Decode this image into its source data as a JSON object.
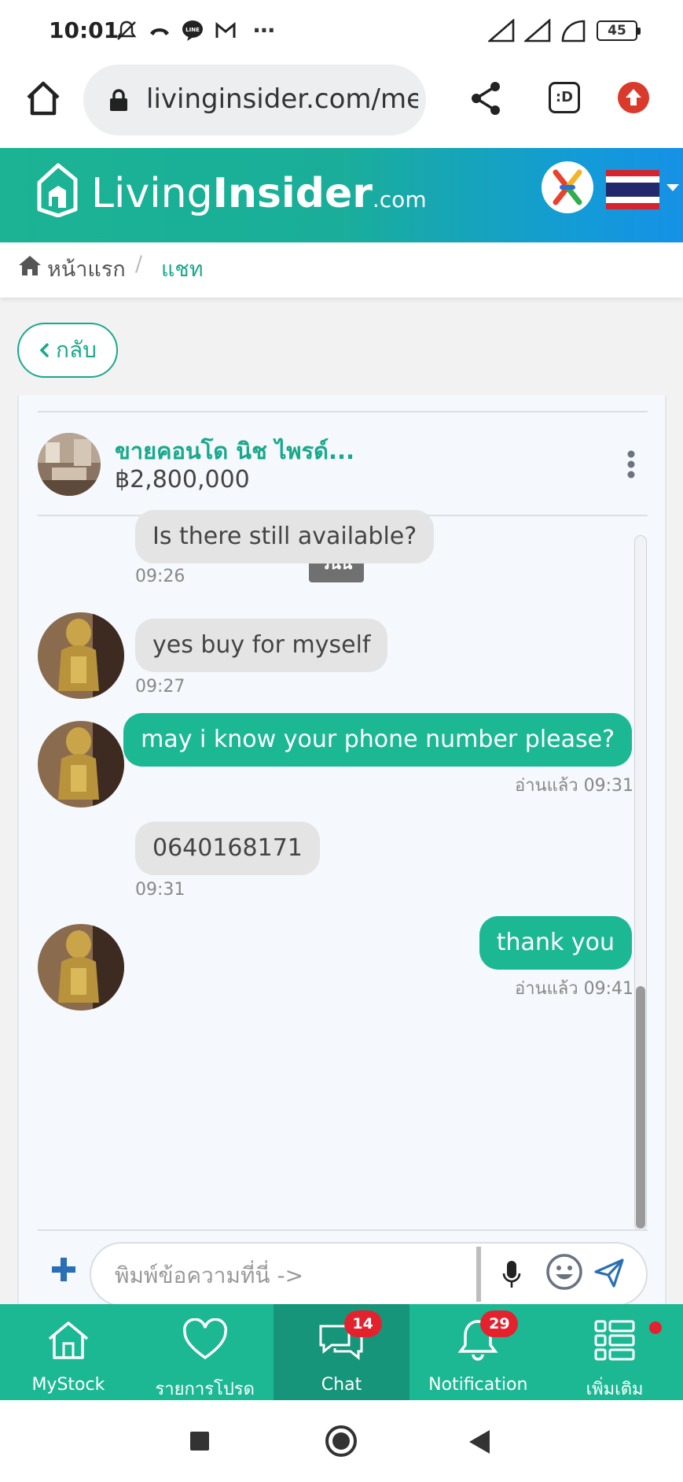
{
  "status_bar": {
    "time": "10:01",
    "more": "⋯",
    "battery": "45",
    "line_icon_text": "LINE",
    "icons": [
      "mute-icon",
      "missed-call-icon",
      "line-app-icon",
      "gmail-icon",
      "signal-icon",
      "signal-icon",
      "wifi-icon",
      "battery-icon"
    ]
  },
  "browser": {
    "url": "livinginsider.com/mer",
    "tab_label": ":D"
  },
  "header": {
    "logo_living": "Living",
    "logo_insider": "Insider",
    "logo_dotcom": ".com"
  },
  "breadcrumb": {
    "home": "หน้าแรก",
    "separator": "/",
    "current": "แชท"
  },
  "back_button": {
    "label": "กลับ"
  },
  "listing": {
    "title": "ขายคอนโด นิช ไพรด์...",
    "price": "฿2,800,000"
  },
  "chat": {
    "date_label": "วันนี้",
    "messages": [
      {
        "dir": "in",
        "text": "Is there still available?",
        "time": "09:26"
      },
      {
        "dir": "in",
        "text": "yes buy for myself",
        "time": "09:27"
      },
      {
        "dir": "out",
        "text": "may i know your phone number please?",
        "time": "อ่านแล้ว  09:31"
      },
      {
        "dir": "in",
        "text": "0640168171",
        "time": "09:31"
      },
      {
        "dir": "out",
        "text": "thank you",
        "time": "อ่านแล้ว  09:41"
      }
    ],
    "input_placeholder": "พิมพ์ข้อความที่นี่ ->",
    "input_value": ""
  },
  "bottom_nav": {
    "items": [
      {
        "label": "MyStock",
        "icon": "home-icon"
      },
      {
        "label": "รายการโปรด",
        "icon": "heart-icon"
      },
      {
        "label": "Chat",
        "icon": "chat-icon",
        "badge": "14",
        "active": true
      },
      {
        "label": "Notification",
        "icon": "bell-icon",
        "badge": "29"
      },
      {
        "label": "เพิ่มเติม",
        "icon": "menu-list-icon"
      }
    ]
  },
  "colors": {
    "brand_green": "#1cb894",
    "active_nav": "#17957a",
    "badge_red": "#e4222e",
    "incoming_bubble": "#e4e4e4"
  }
}
